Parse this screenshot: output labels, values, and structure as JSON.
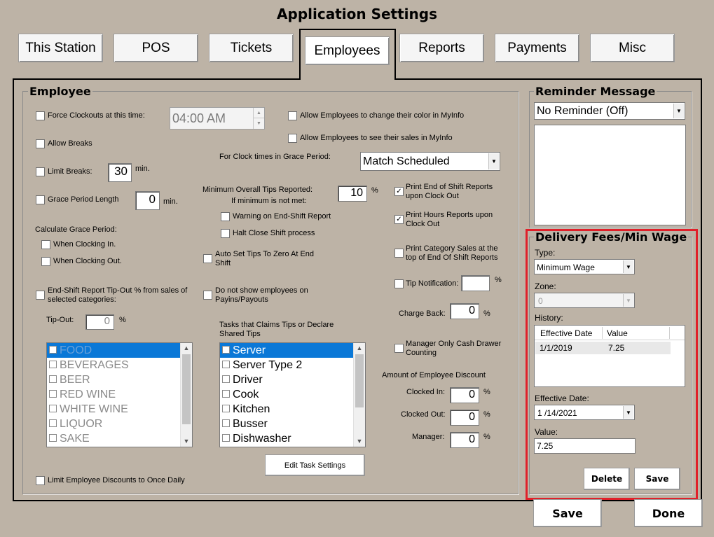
{
  "window": {
    "title": "Application Settings"
  },
  "tabs": [
    {
      "label": "This Station",
      "active": false
    },
    {
      "label": "POS",
      "active": false
    },
    {
      "label": "Tickets",
      "active": false
    },
    {
      "label": "Employees",
      "active": true
    },
    {
      "label": "Reports",
      "active": false
    },
    {
      "label": "Payments",
      "active": false
    },
    {
      "label": "Misc",
      "active": false
    }
  ],
  "employee": {
    "section_title": "Employee",
    "force_clockouts": {
      "label": "Force Clockouts at this time:",
      "checked": false,
      "time_value": "04:00 AM"
    },
    "allow_breaks": {
      "label": "Allow Breaks",
      "checked": false
    },
    "limit_breaks": {
      "label": "Limit Breaks:",
      "checked": false,
      "value": "30",
      "unit": "min."
    },
    "grace_period_length": {
      "label": "Grace Period Length",
      "checked": false,
      "value": "0",
      "unit": "min."
    },
    "calc_grace_label": "Calculate Grace Period:",
    "when_clocking_in": {
      "label": "When Clocking In.",
      "checked": false
    },
    "when_clocking_out": {
      "label": "When Clocking Out.",
      "checked": false
    },
    "tipout_categories": {
      "label": "End-Shift Report Tip-Out % from sales of selected categories:",
      "checked": false
    },
    "tipout": {
      "label": "Tip-Out:",
      "value": "0",
      "unit": "%"
    },
    "categories": [
      "FOOD",
      "BEVERAGES",
      "BEER",
      "RED WINE",
      "WHITE WINE",
      "LIQUOR",
      "SAKE"
    ],
    "limit_discounts": {
      "label": "Limit Employee Discounts to Once Daily",
      "checked": false
    },
    "allow_color": {
      "label": "Allow Employees to change their color in MyInfo",
      "checked": false
    },
    "allow_sales": {
      "label": "Allow Employees to see their sales in MyInfo",
      "checked": false
    },
    "clock_grace": {
      "label": "For Clock times in Grace Period:",
      "value": "Match Scheduled"
    },
    "min_tips": {
      "label": "Minimum Overall Tips Reported:",
      "sub_label": "If minimum is not met:",
      "value": "10",
      "unit": "%"
    },
    "warning_endshift": {
      "label": "Warning on End-Shift Report",
      "checked": false
    },
    "halt_close": {
      "label": "Halt Close Shift process",
      "checked": false
    },
    "auto_set_tips": {
      "label": "Auto Set Tips To Zero At End Shift",
      "checked": false
    },
    "do_not_show": {
      "label": "Do not show employees on Payins/Payouts",
      "checked": false
    },
    "tasks_label": "Tasks that Claims Tips or Declare Shared Tips",
    "tasks": [
      "Server",
      "Server Type 2",
      "Driver",
      "Cook",
      "Kitchen",
      "Busser",
      "Dishwasher"
    ],
    "edit_task_button": "Edit Task Settings",
    "print_end_shift": {
      "label": "Print End of Shift Reports upon Clock Out",
      "checked": true
    },
    "print_hours": {
      "label": "Print Hours Reports upon Clock Out",
      "checked": true
    },
    "print_category": {
      "label": "Print Category Sales at the top of End Of Shift Reports",
      "checked": false
    },
    "tip_notification": {
      "label": "Tip Notification:",
      "checked": false,
      "value": "",
      "unit": "%"
    },
    "charge_back": {
      "label": "Charge Back:",
      "value": "0",
      "unit": "%"
    },
    "manager_cash": {
      "label": "Manager Only Cash Drawer Counting",
      "checked": false
    },
    "discount_label": "Amount of Employee Discount",
    "clocked_in": {
      "label": "Clocked In:",
      "value": "0",
      "unit": "%"
    },
    "clocked_out": {
      "label": "Clocked Out:",
      "value": "0",
      "unit": "%"
    },
    "manager": {
      "label": "Manager:",
      "value": "0",
      "unit": "%"
    }
  },
  "reminder": {
    "section_title": "Reminder Message",
    "select_value": "No Reminder (Off)",
    "message": ""
  },
  "delivery": {
    "section_title": "Delivery Fees/Min Wage",
    "type_label": "Type:",
    "type_value": "Minimum Wage",
    "zone_label": "Zone:",
    "zone_value": "0",
    "history_label": "History:",
    "history_columns": [
      "Effective Date",
      "Value"
    ],
    "history_rows": [
      {
        "date": "1/1/2019",
        "value": "7.25"
      }
    ],
    "effective_date_label": "Effective Date:",
    "effective_date_value": "1 /14/2021",
    "value_label": "Value:",
    "value_value": "7.25",
    "delete_button": "Delete",
    "save_button": "Save",
    "highlight_color": "#e0202a"
  },
  "footer": {
    "save_button": "Save",
    "done_button": "Done"
  }
}
